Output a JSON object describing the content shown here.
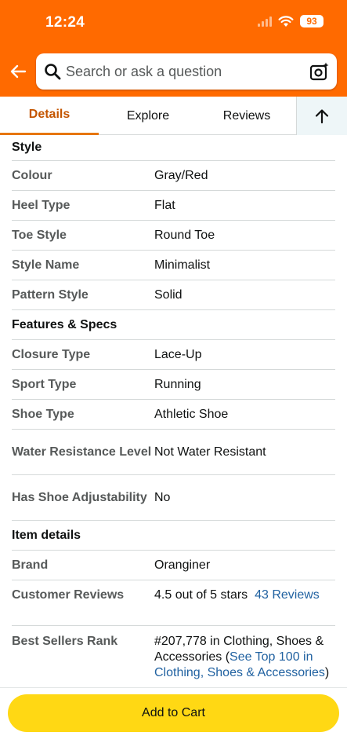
{
  "status_bar": {
    "time": "12:24",
    "battery": "93"
  },
  "search": {
    "placeholder": "Search or ask a question"
  },
  "tabs": [
    {
      "label": "Details",
      "active": true
    },
    {
      "label": "Explore",
      "active": false
    },
    {
      "label": "Reviews",
      "active": false
    }
  ],
  "sections": {
    "style": {
      "title": "Style",
      "rows": [
        {
          "key": "Colour",
          "value": "Gray/Red"
        },
        {
          "key": "Heel Type",
          "value": "Flat"
        },
        {
          "key": "Toe Style",
          "value": "Round Toe"
        },
        {
          "key": "Style Name",
          "value": "Minimalist"
        },
        {
          "key": "Pattern Style",
          "value": "Solid"
        }
      ]
    },
    "features": {
      "title": "Features & Specs",
      "rows": [
        {
          "key": "Closure Type",
          "value": "Lace-Up"
        },
        {
          "key": "Sport Type",
          "value": "Running"
        },
        {
          "key": "Shoe Type",
          "value": "Athletic Shoe"
        },
        {
          "key": "Water Resistance Level",
          "value": "Not Water Resistant"
        },
        {
          "key": "Has Shoe Adjustability",
          "value": "No"
        }
      ]
    },
    "item_details": {
      "title": "Item details",
      "rows": [
        {
          "key": "Brand",
          "value": "Oranginer"
        },
        {
          "key": "Customer Reviews",
          "value": "4.5 out of 5 stars",
          "link": "43 Reviews"
        },
        {
          "key": "Best Sellers Rank",
          "value": "#207,778 in Clothing, Shoes & Accessories (",
          "link": "See Top 100 in Clothing, Shoes & Accessories",
          "suffix": ")"
        }
      ]
    }
  },
  "cart": {
    "label": "Add to Cart"
  },
  "colors": {
    "header": "#ff6a00",
    "active_tab": "#c45500",
    "cart_button": "#ffd814",
    "link": "#2162a1"
  }
}
